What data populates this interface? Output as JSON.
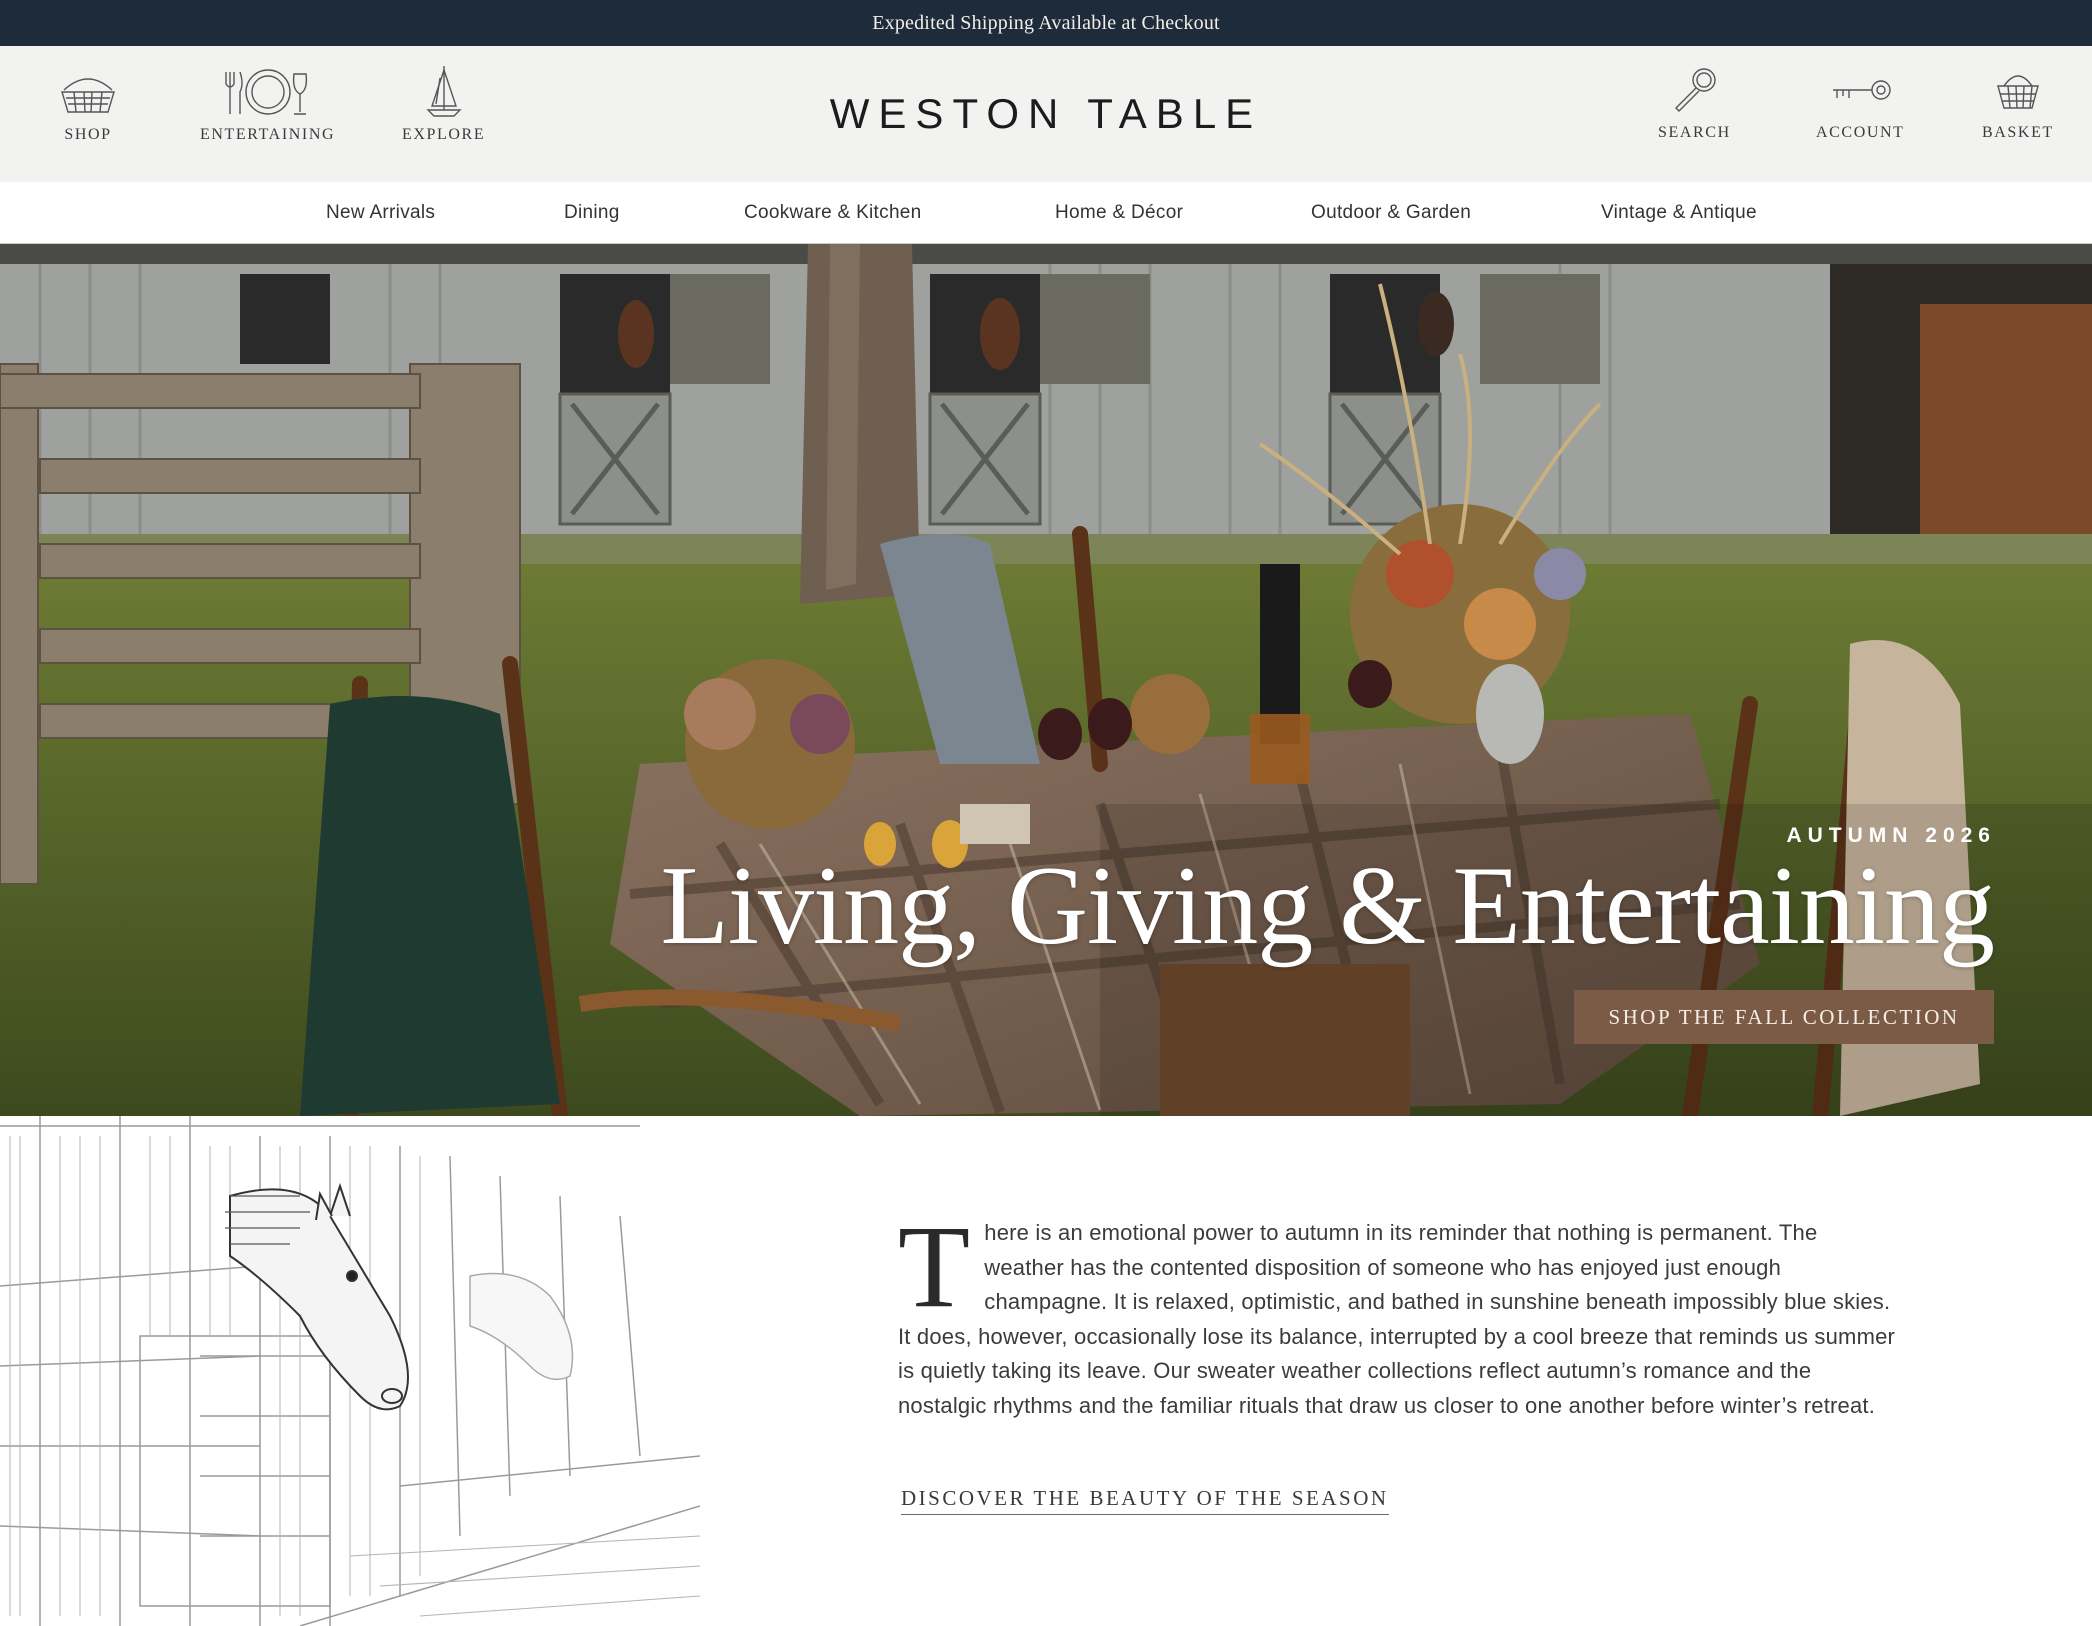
{
  "announcement": {
    "text": "Expedited Shipping Available at Checkout"
  },
  "header": {
    "logo": "WESTON TABLE",
    "left_items": [
      {
        "label": "SHOP",
        "icon": "picnic-basket-icon"
      },
      {
        "label": "ENTERTAINING",
        "icon": "place-setting-icon"
      },
      {
        "label": "EXPLORE",
        "icon": "sailboat-icon"
      }
    ],
    "right_items": [
      {
        "label": "SEARCH",
        "icon": "magnifying-glass-icon"
      },
      {
        "label": "ACCOUNT",
        "icon": "key-icon"
      },
      {
        "label": "BASKET",
        "icon": "basket-icon"
      }
    ]
  },
  "nav": {
    "items": [
      "New Arrivals",
      "Dining",
      "Cookware & Kitchen",
      "Home & Décor",
      "Outdoor & Garden",
      "Vintage & Antique"
    ]
  },
  "hero": {
    "eyebrow": "AUTUMN 2026",
    "title": "Living, Giving & Entertaining",
    "cta": "SHOP THE FALL COLLECTION"
  },
  "story": {
    "dropcap": "T",
    "body": "here is an emotional power to autumn in its reminder that nothing is permanent. The weather has the contented disposition of someone who has enjoyed just enough champagne. It is relaxed, optimistic, and bathed in sunshine beneath impossibly blue skies. It does, however, occasionally lose its balance, interrupted by a cool breeze that reminds us summer is quietly taking its leave. Our sweater weather collections reflect autumn’s romance and the nostalgic rhythms and the familiar rituals that draw us closer to one another before winter’s retreat.",
    "link": "DISCOVER THE BEAUTY OF THE SEASON"
  },
  "colors": {
    "announcement_bg": "#1e2b3b",
    "header_bg": "#f2f3f1",
    "cta_bg": "#7b5b46"
  }
}
